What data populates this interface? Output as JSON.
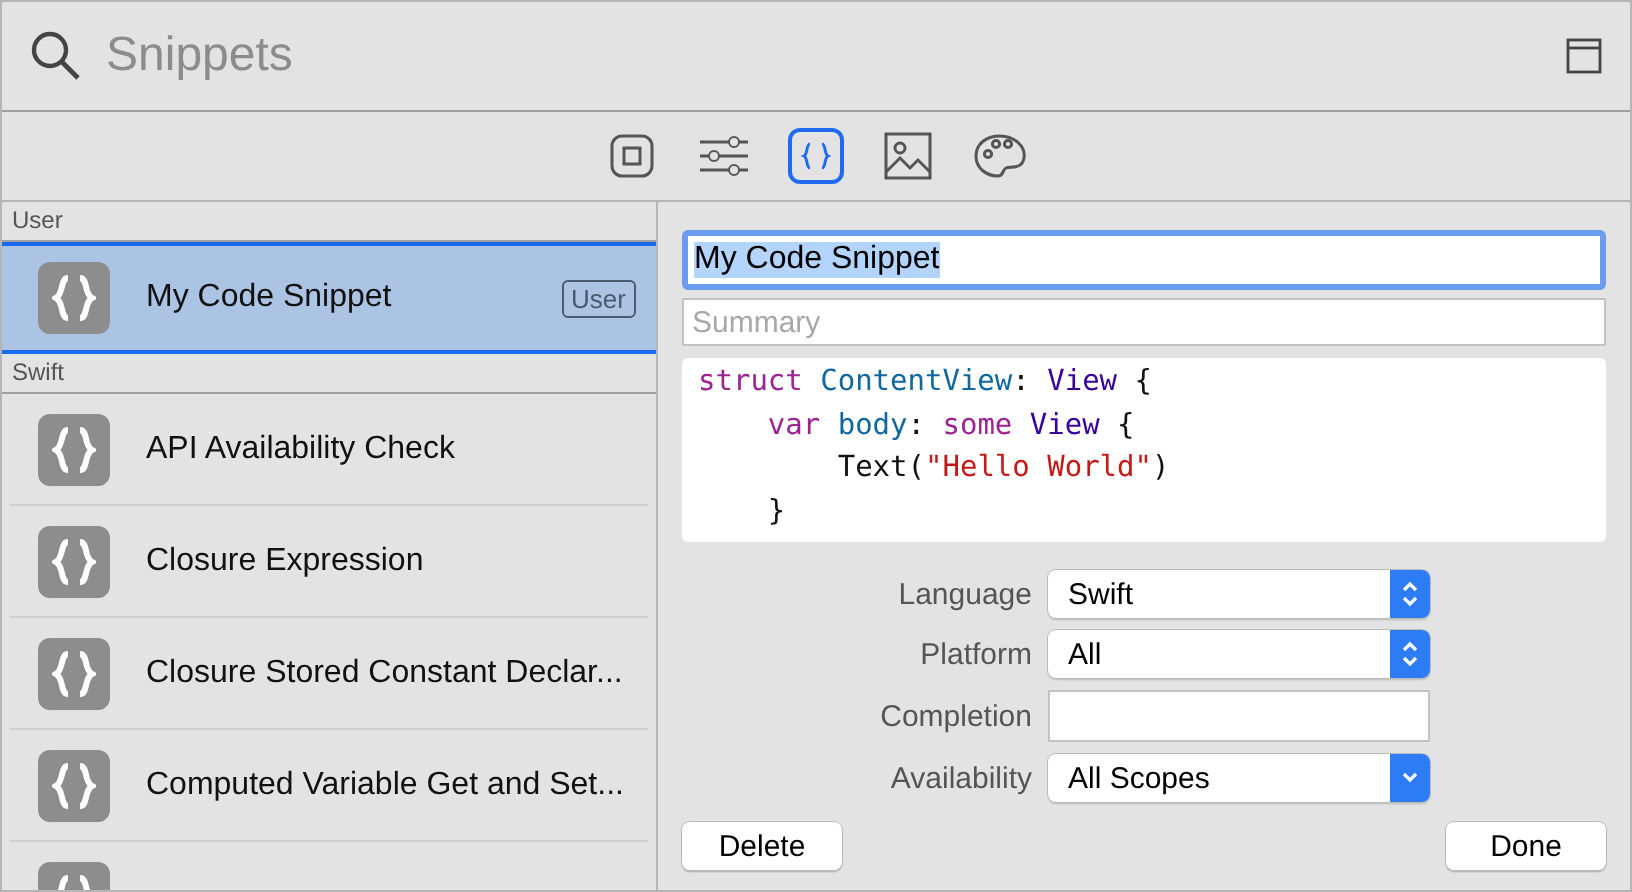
{
  "search": {
    "placeholder": "Snippets"
  },
  "library_tabs": [
    {
      "kind": "objects",
      "selected": false
    },
    {
      "kind": "modifiers",
      "selected": false
    },
    {
      "kind": "snippets",
      "selected": true
    },
    {
      "kind": "media",
      "selected": false
    },
    {
      "kind": "colors",
      "selected": false
    }
  ],
  "sections": [
    {
      "title": "User",
      "items": [
        {
          "name": "My Code Snippet",
          "badge": "User",
          "selected": true
        }
      ]
    },
    {
      "title": "Swift",
      "items": [
        {
          "name": "API Availability Check",
          "selected": false
        },
        {
          "name": "Closure Expression",
          "selected": false
        },
        {
          "name": "Closure Stored Constant Declar...",
          "selected": false
        },
        {
          "name": "Computed Variable Get and Set...",
          "selected": false
        },
        {
          "selected": false
        }
      ]
    }
  ],
  "detail": {
    "title_value": "My Code Snippet",
    "summary_placeholder": "Summary",
    "code": [
      [
        {
          "text": "struct ",
          "kind": "keyword"
        },
        {
          "text": "ContentView",
          "kind": "declaration"
        },
        {
          "text": ": ",
          "kind": "plain"
        },
        {
          "text": "View",
          "kind": "type"
        },
        {
          "text": " {",
          "kind": "plain"
        }
      ],
      [
        {
          "text": "    var ",
          "kind": "keyword"
        },
        {
          "text": "body",
          "kind": "declaration"
        },
        {
          "text": ": ",
          "kind": "plain"
        },
        {
          "text": "some ",
          "kind": "keyword"
        },
        {
          "text": "View",
          "kind": "type"
        },
        {
          "text": " {",
          "kind": "plain"
        }
      ],
      [
        {
          "text": "        Text(",
          "kind": "plain"
        },
        {
          "text": "\"Hello World\"",
          "kind": "string"
        },
        {
          "text": ")",
          "kind": "plain"
        }
      ],
      [
        {
          "text": "    }",
          "kind": "plain"
        }
      ]
    ],
    "fields": [
      {
        "label": "Language",
        "kind": "stepper-select",
        "value": "Swift"
      },
      {
        "label": "Platform",
        "kind": "stepper-select",
        "value": "All"
      },
      {
        "label": "Completion",
        "kind": "text"
      },
      {
        "label": "Availability",
        "kind": "dropdown",
        "value": "All Scopes"
      }
    ],
    "buttons": [
      "Delete",
      "Done"
    ]
  }
}
